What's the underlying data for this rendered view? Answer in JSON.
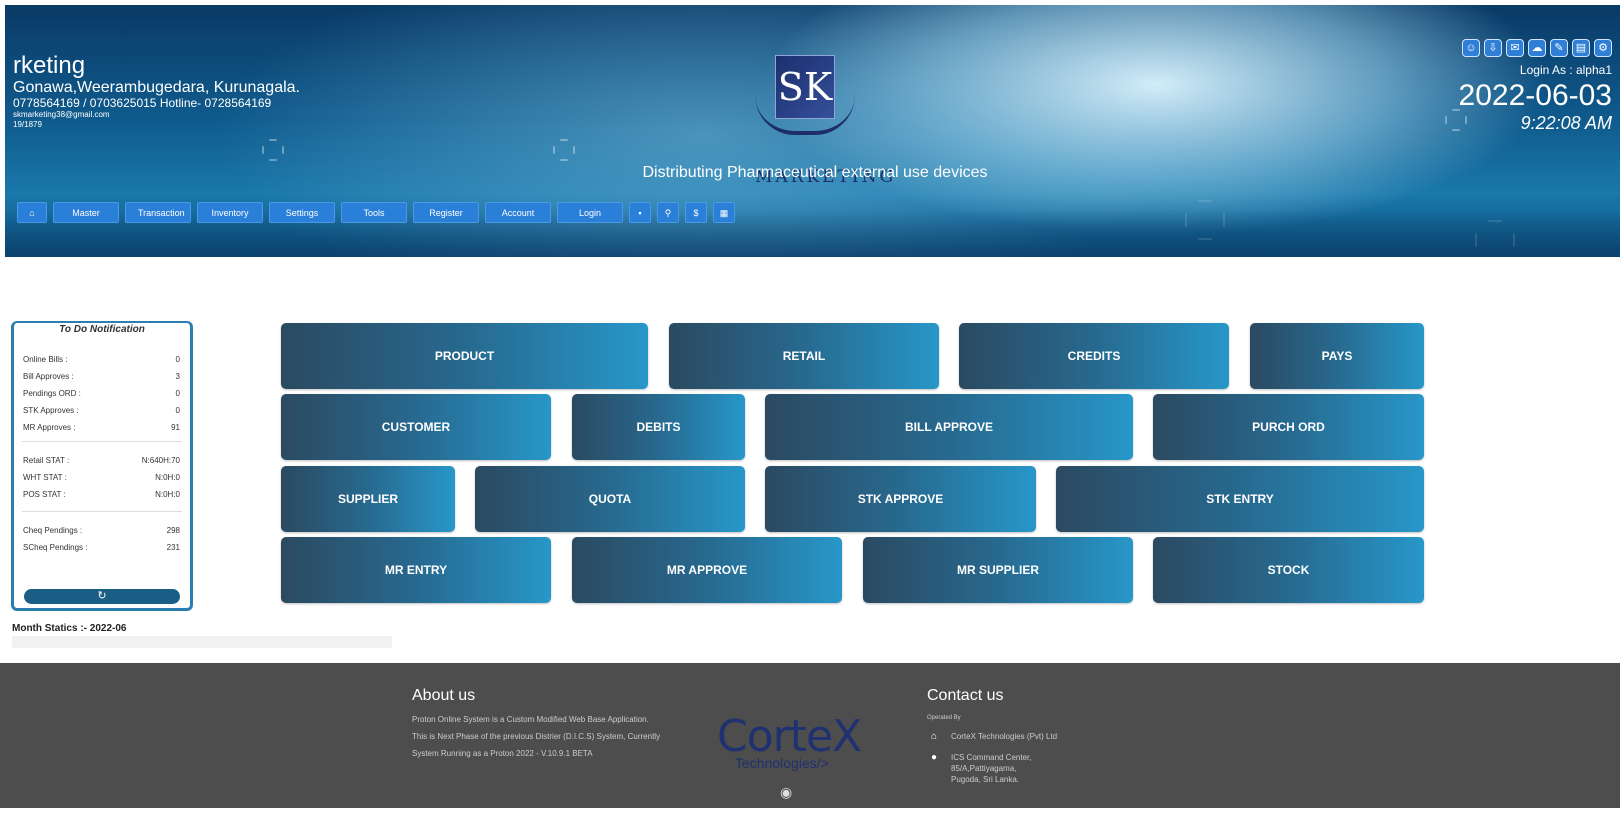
{
  "header": {
    "company_name": "rketing",
    "address": "Gonawa,Weerambugedara, Kurunagala.",
    "phones": "0778564169 / 0703625015 Hotline- 0728564169",
    "email": "skmarketing38@gmail.com",
    "reg_no": "19/1879",
    "logo_letters": "SK",
    "logo_text": "MARKETING",
    "tagline": "Distributing Pharmaceutical external use devices",
    "login_as": "Login As : alpha1",
    "date": "2022-06-03",
    "time": "9:22:08 AM",
    "top_icons": [
      "users-icon",
      "download-icon",
      "chat-icon",
      "cloud-upload-icon",
      "tools-icon",
      "document-icon",
      "settings-icon"
    ]
  },
  "nav": {
    "home_icon": "⌂",
    "items": [
      "Master",
      "Transaction",
      "Inventory",
      "Settings",
      "Tools",
      "Register",
      "Account",
      "Login"
    ],
    "icon_buttons": [
      "▪",
      "⚲",
      "$",
      "▦"
    ]
  },
  "todo": {
    "title": "To Do Notification",
    "group1": [
      {
        "label": "Online Bills :",
        "value": "0"
      },
      {
        "label": "Bill Approves :",
        "value": "3"
      },
      {
        "label": "Pendings ORD :",
        "value": "0"
      },
      {
        "label": "STK Approves :",
        "value": "0"
      },
      {
        "label": "MR Approves :",
        "value": "91"
      }
    ],
    "group2": [
      {
        "label": "Retail STAT :",
        "value": "N:640H:70"
      },
      {
        "label": "WHT STAT :",
        "value": "N:0H:0"
      },
      {
        "label": "POS STAT :",
        "value": "N:0H:0"
      }
    ],
    "group3": [
      {
        "label": "Cheq Pendings :",
        "value": "298"
      },
      {
        "label": "SCheq Pendings :",
        "value": "231"
      }
    ],
    "refresh_icon": "↻"
  },
  "month_statics": "Month Statics :- 2022-06",
  "tiles": [
    "PRODUCT",
    "RETAIL",
    "CREDITS",
    "PAYS",
    "CUSTOMER",
    "DEBITS",
    "BILL APPROVE",
    "PURCH ORD",
    "SUPPLIER",
    "QUOTA",
    "STK APPROVE",
    "STK ENTRY",
    "MR ENTRY",
    "MR APPROVE",
    "MR SUPPLIER",
    "STOCK"
  ],
  "footer": {
    "about_title": "About us",
    "about_text": "Proton Online System is a Custom Modified Web Base Application. This is Next Phase of the previous Distrier (D.I.C.S) System, Currently System Running as a Proton 2022 - V.10.9.1 BETA",
    "brand_big": "CorteX",
    "brand_sub": "Technologies/>",
    "eye_icon": "◉",
    "contact_title": "Contact us",
    "operated_by": "Operated By",
    "company": "CorteX Technologies (Pvt) Ltd",
    "address_lines": [
      "ICS Command Center,",
      "85/A,Pattiyagama,",
      "Pugoda, Sri Lanka."
    ]
  }
}
